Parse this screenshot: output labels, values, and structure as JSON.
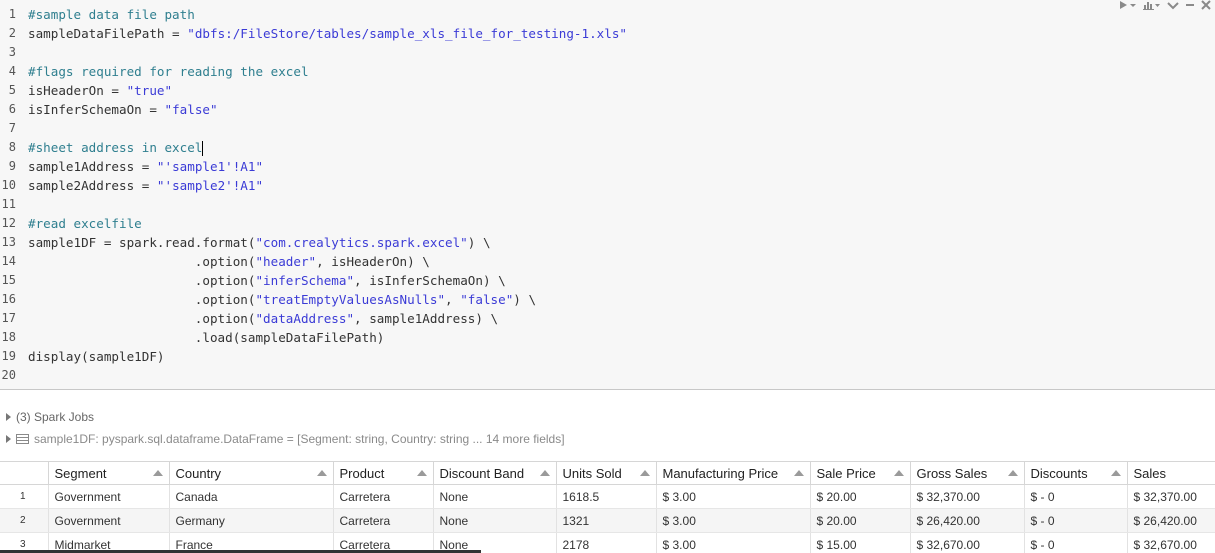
{
  "toolbar": {
    "icons": [
      "run-icon",
      "chart-icon",
      "collapse-icon",
      "minimize-icon",
      "close-icon"
    ]
  },
  "editor": {
    "lines": [
      {
        "num": "1",
        "segments": [
          {
            "t": "#sample data file path",
            "k": "comment"
          }
        ]
      },
      {
        "num": "2",
        "segments": [
          {
            "t": "sampleDataFilePath = ",
            "k": "plain"
          },
          {
            "t": "\"dbfs:/FileStore/tables/sample_xls_file_for_testing-1.xls\"",
            "k": "string"
          }
        ]
      },
      {
        "num": "3",
        "segments": []
      },
      {
        "num": "4",
        "segments": [
          {
            "t": "#flags required for reading the excel",
            "k": "comment"
          }
        ]
      },
      {
        "num": "5",
        "segments": [
          {
            "t": "isHeaderOn = ",
            "k": "plain"
          },
          {
            "t": "\"true\"",
            "k": "string"
          }
        ]
      },
      {
        "num": "6",
        "segments": [
          {
            "t": "isInferSchemaOn = ",
            "k": "plain"
          },
          {
            "t": "\"false\"",
            "k": "string"
          }
        ]
      },
      {
        "num": "7",
        "segments": []
      },
      {
        "num": "8",
        "segments": [
          {
            "t": "#sheet address in excel",
            "k": "comment"
          }
        ],
        "caret": true
      },
      {
        "num": "9",
        "segments": [
          {
            "t": "sample1Address = ",
            "k": "plain"
          },
          {
            "t": "\"'sample1'!A1\"",
            "k": "string"
          }
        ]
      },
      {
        "num": "10",
        "segments": [
          {
            "t": "sample2Address = ",
            "k": "plain"
          },
          {
            "t": "\"'sample2'!A1\"",
            "k": "string"
          }
        ]
      },
      {
        "num": "11",
        "segments": []
      },
      {
        "num": "12",
        "segments": [
          {
            "t": "#read excelfile",
            "k": "comment"
          }
        ]
      },
      {
        "num": "13",
        "segments": [
          {
            "t": "sample1DF = spark.read.format(",
            "k": "plain"
          },
          {
            "t": "\"com.crealytics.spark.excel\"",
            "k": "string"
          },
          {
            "t": ") \\",
            "k": "plain"
          }
        ]
      },
      {
        "num": "14",
        "segments": [
          {
            "t": "                      .option(",
            "k": "plain"
          },
          {
            "t": "\"header\"",
            "k": "string"
          },
          {
            "t": ", isHeaderOn) \\",
            "k": "plain"
          }
        ]
      },
      {
        "num": "15",
        "segments": [
          {
            "t": "                      .option(",
            "k": "plain"
          },
          {
            "t": "\"inferSchema\"",
            "k": "string"
          },
          {
            "t": ", isInferSchemaOn) \\",
            "k": "plain"
          }
        ]
      },
      {
        "num": "16",
        "segments": [
          {
            "t": "                      .option(",
            "k": "plain"
          },
          {
            "t": "\"treatEmptyValuesAsNulls\"",
            "k": "string"
          },
          {
            "t": ", ",
            "k": "plain"
          },
          {
            "t": "\"false\"",
            "k": "string"
          },
          {
            "t": ") \\",
            "k": "plain"
          }
        ]
      },
      {
        "num": "17",
        "segments": [
          {
            "t": "                      .option(",
            "k": "plain"
          },
          {
            "t": "\"dataAddress\"",
            "k": "string"
          },
          {
            "t": ", sample1Address) \\",
            "k": "plain"
          }
        ]
      },
      {
        "num": "18",
        "segments": [
          {
            "t": "                      .load(sampleDataFilePath)",
            "k": "plain"
          }
        ]
      },
      {
        "num": "19",
        "segments": [
          {
            "t": "display(sample1DF)",
            "k": "plain"
          }
        ]
      },
      {
        "num": "20",
        "segments": []
      }
    ]
  },
  "output": {
    "spark_jobs": "(3) Spark Jobs",
    "dataframe_info": "sample1DF:  pyspark.sql.dataframe.DataFrame = [Segment: string, Country: string ... 14 more fields]",
    "table": {
      "columns": [
        "Segment",
        "Country",
        "Product",
        "Discount Band",
        "Units Sold",
        "Manufacturing Price",
        "Sale Price",
        "Gross Sales",
        "Discounts",
        "Sales"
      ],
      "rows": [
        {
          "idx": "1",
          "cells": [
            "Government",
            "Canada",
            "Carretera",
            "None",
            "1618.5",
            "$ 3.00",
            "$ 20.00",
            "$ 32,370.00",
            "$ - 0",
            "$ 32,370.00"
          ]
        },
        {
          "idx": "2",
          "cells": [
            "Government",
            "Germany",
            "Carretera",
            "None",
            "1321",
            "$ 3.00",
            "$ 20.00",
            "$ 26,420.00",
            "$ - 0",
            "$ 26,420.00"
          ]
        },
        {
          "idx": "3",
          "cells": [
            "Midmarket",
            "France",
            "Carretera",
            "None",
            "2178",
            "$ 3.00",
            "$ 15.00",
            "$ 32,670.00",
            "$ - 0",
            "$ 32,670.00"
          ]
        }
      ]
    }
  }
}
